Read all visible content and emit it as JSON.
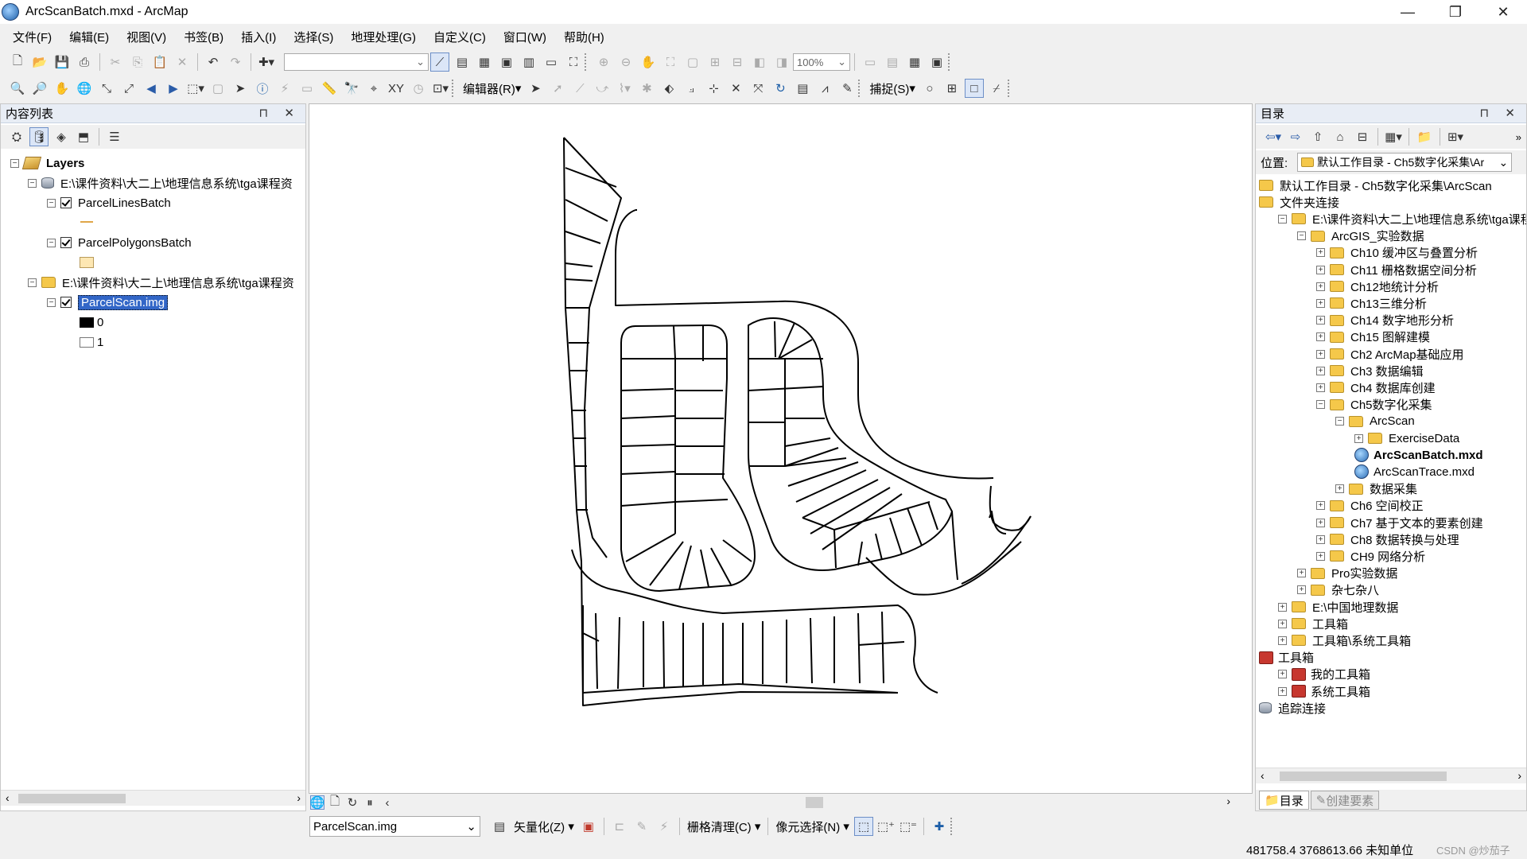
{
  "window": {
    "title": "ArcScanBatch.mxd - ArcMap",
    "minimize": "—",
    "restore": "❐",
    "close": "✕"
  },
  "menu": [
    "文件(F)",
    "编辑(E)",
    "视图(V)",
    "书签(B)",
    "插入(I)",
    "选择(S)",
    "地理处理(G)",
    "自定义(C)",
    "窗口(W)",
    "帮助(H)"
  ],
  "toolbar1": {
    "scale_value": "",
    "zoom_value": "100%"
  },
  "toolbar2": {
    "editor_label": "编辑器(R)",
    "snapping_label": "捕捉(S)"
  },
  "toc": {
    "title": "内容列表",
    "pin": "⊓ ✕",
    "rows": [
      {
        "label": "Layers"
      },
      {
        "label": "E:\\课件资料\\大二上\\地理信息系统\\tga课程资"
      },
      {
        "label": "ParcelLinesBatch"
      },
      {
        "label": "ParcelPolygonsBatch"
      },
      {
        "label": "E:\\课件资料\\大二上\\地理信息系统\\tga课程资"
      },
      {
        "label": "ParcelScan.img"
      },
      {
        "label": "0"
      },
      {
        "label": "1"
      }
    ]
  },
  "catalog": {
    "title": "目录",
    "location_label": "位置:",
    "location_value": "默认工作目录 - Ch5数字化采集\\Ar",
    "tabs": {
      "catalog": "目录",
      "create_features": "创建要素"
    },
    "rows": [
      {
        "label": "默认工作目录 - Ch5数字化采集\\ArcScan"
      },
      {
        "label": "文件夹连接"
      },
      {
        "label": "E:\\课件资料\\大二上\\地理信息系统\\tga课程"
      },
      {
        "label": "ArcGIS_实验数据"
      },
      {
        "label": "Ch10 缓冲区与叠置分析"
      },
      {
        "label": "Ch11 栅格数据空间分析"
      },
      {
        "label": "Ch12地统计分析"
      },
      {
        "label": "Ch13三维分析"
      },
      {
        "label": "Ch14 数字地形分析"
      },
      {
        "label": "Ch15 图解建模"
      },
      {
        "label": "Ch2  ArcMap基础应用"
      },
      {
        "label": "Ch3 数据编辑"
      },
      {
        "label": "Ch4 数据库创建"
      },
      {
        "label": "Ch5数字化采集"
      },
      {
        "label": "ArcScan"
      },
      {
        "label": "ExerciseData"
      },
      {
        "label": "ArcScanBatch.mxd"
      },
      {
        "label": "ArcScanTrace.mxd"
      },
      {
        "label": "数据采集"
      },
      {
        "label": "Ch6 空间校正"
      },
      {
        "label": "Ch7 基于文本的要素创建"
      },
      {
        "label": "Ch8 数据转换与处理"
      },
      {
        "label": "CH9 网络分析"
      },
      {
        "label": "Pro实验数据"
      },
      {
        "label": "杂七杂八"
      },
      {
        "label": "E:\\中国地理数据"
      },
      {
        "label": "工具箱"
      },
      {
        "label": "工具箱\\系统工具箱"
      },
      {
        "label": "工具箱"
      },
      {
        "label": "我的工具箱"
      },
      {
        "label": "系统工具箱"
      },
      {
        "label": "追踪连接"
      }
    ]
  },
  "arcscan": {
    "raster_layer": "ParcelScan.img",
    "vectorization": "矢量化(Z)",
    "raster_cleanup": "栅格清理(C)",
    "cell_selection": "像元选择(N)"
  },
  "status": {
    "coords": "481758.4  3768613.66 未知单位",
    "watermark": "CSDN @炒茄子"
  }
}
